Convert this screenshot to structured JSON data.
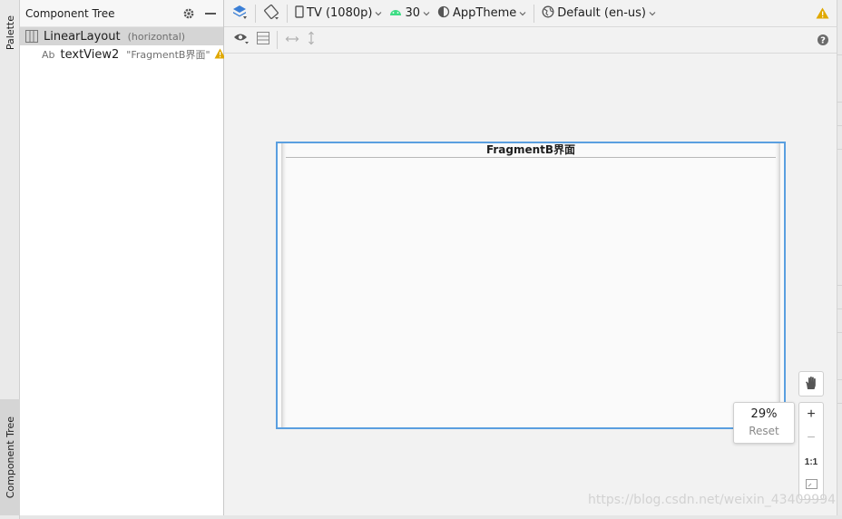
{
  "left_strip": {
    "palette_tab": "Palette",
    "component_tree_tab": "Component Tree"
  },
  "tree_panel": {
    "title": "Component Tree",
    "rows": [
      {
        "name": "LinearLayout",
        "detail": "(horizontal)",
        "icon": "linear-layout-icon",
        "selected": true
      },
      {
        "prefix": "Ab",
        "name": "textView2",
        "detail": "\"FragmentB界面\"",
        "icon": "textview-icon",
        "warning": true
      }
    ]
  },
  "toolbar": {
    "device": "TV (1080p)",
    "api": "30",
    "theme": "AppTheme",
    "locale": "Default (en-us)"
  },
  "preview": {
    "text": "FragmentB界面"
  },
  "zoom": {
    "value": "29%",
    "reset": "Reset",
    "plus": "+",
    "minus": "−",
    "one_to_one": "1:1"
  },
  "watermark": "https://blog.csdn.net/weixin_43409994",
  "colors": {
    "accent_blue": "#3b7fd6",
    "device_border": "#5a9fe0",
    "android_green": "#3ddc84",
    "warning": "#e0a800"
  }
}
